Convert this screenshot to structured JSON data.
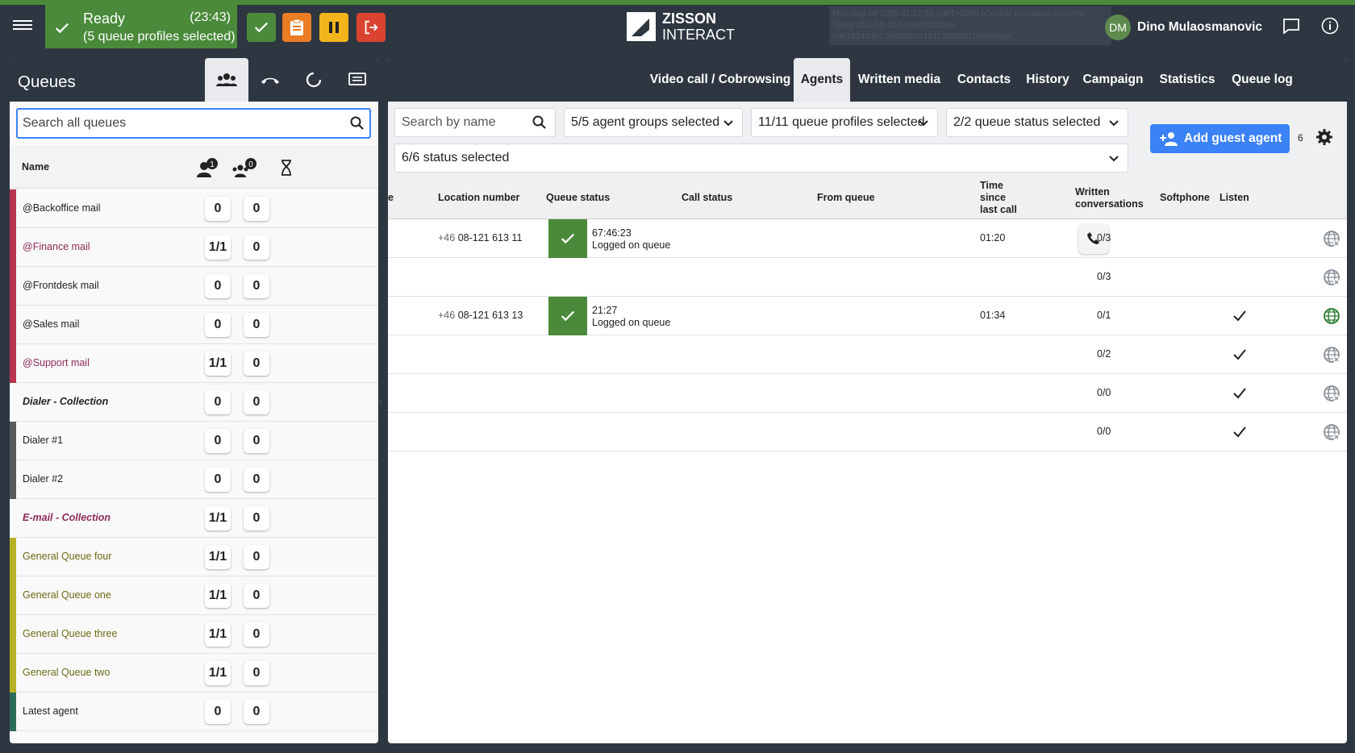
{
  "topbar": {
    "status": "Ready",
    "time": "(23:43)",
    "subtitle": "(5 queue profiles selected)",
    "brand_line1": "ZISSON",
    "brand_line2": "INTERACT",
    "version_info": "Mon Sep 08 2025 11:57:51 GMT+0200 (Central European Summer Time) 25.04.8-432-gcd67d345de cd67d345de17b66f0c4518112f682611beba4aaf",
    "user_initials": "DM",
    "user_name": "Dino Mulaosmanovic",
    "colors": {
      "ready": "#4a8a3a",
      "orange": "#ea7c22",
      "yellow": "#f2b51c",
      "red": "#d9432f",
      "accent_blue": "#3b82f6"
    }
  },
  "left": {
    "title": "Queues",
    "search_placeholder": "Search all queues",
    "col_name": "Name",
    "badge_agents": "1",
    "badge_groups": "0",
    "queues": [
      {
        "name": "@Backoffice mail",
        "a": "0",
        "b": "0",
        "color": "#b8334f",
        "style": "normal"
      },
      {
        "name": "@Finance mail",
        "a": "1/1",
        "b": "0",
        "color": "#b8334f",
        "style": "pink"
      },
      {
        "name": "@Frontdesk mail",
        "a": "0",
        "b": "0",
        "color": "#b8334f",
        "style": "normal"
      },
      {
        "name": "@Sales mail",
        "a": "0",
        "b": "0",
        "color": "#b8334f",
        "style": "normal"
      },
      {
        "name": "@Support mail",
        "a": "1/1",
        "b": "0",
        "color": "#b8334f",
        "style": "pink"
      },
      {
        "name": "Dialer - Collection",
        "a": "0",
        "b": "0",
        "color": "#f9f9f9",
        "style": "bold"
      },
      {
        "name": "Dialer #1",
        "a": "0",
        "b": "0",
        "color": "#5a5a5a",
        "style": "normal"
      },
      {
        "name": "Dialer #2",
        "a": "0",
        "b": "0",
        "color": "#5a5a5a",
        "style": "normal"
      },
      {
        "name": "E-mail - Collection",
        "a": "1/1",
        "b": "0",
        "color": "#f9f9f9",
        "style": "bold pink"
      },
      {
        "name": "General Queue four",
        "a": "1/1",
        "b": "0",
        "color": "#b7b325",
        "style": "olive"
      },
      {
        "name": "General Queue one",
        "a": "1/1",
        "b": "0",
        "color": "#b7b325",
        "style": "olive"
      },
      {
        "name": "General Queue three",
        "a": "1/1",
        "b": "0",
        "color": "#b7b325",
        "style": "olive"
      },
      {
        "name": "General Queue two",
        "a": "1/1",
        "b": "0",
        "color": "#b7b325",
        "style": "olive"
      },
      {
        "name": "Latest agent",
        "a": "0",
        "b": "0",
        "color": "#2f6b5a",
        "style": "normal"
      }
    ]
  },
  "right": {
    "tabs": [
      "Video call / Cobrowsing",
      "Agents",
      "Written media",
      "Contacts",
      "History",
      "Campaign",
      "Statistics",
      "Queue log"
    ],
    "search_placeholder": "Search by name",
    "filter_groups": "5/5 agent groups selected",
    "filter_profiles": "11/11 queue profiles selected",
    "filter_qstatus": "2/2 queue status selected",
    "filter_status": "6/6 status selected",
    "add_guest": "Add guest agent",
    "count": "6",
    "columns": {
      "partial": "e",
      "location": "Location number",
      "queue_status": "Queue status",
      "call_status": "Call status",
      "from_queue": "From queue",
      "time_since_1": "Time",
      "time_since_2": "since",
      "time_since_3": "last call",
      "written_1": "Written",
      "written_2": "conversations",
      "softphone": "Softphone",
      "listen": "Listen"
    },
    "rows": [
      {
        "prefix": "+46",
        "number": "08-121 613 11",
        "qtime": "67:46:23",
        "qstate": "Logged on queue",
        "since": "01:20",
        "written": "0/3",
        "softphone": false,
        "listen_active": false,
        "show_status": true,
        "phone": true
      },
      {
        "prefix": "",
        "number": "",
        "qtime": "",
        "qstate": "",
        "since": "",
        "written": "0/3",
        "softphone": false,
        "listen_active": false,
        "show_status": false,
        "phone": false
      },
      {
        "prefix": "+46",
        "number": "08-121 613 13",
        "qtime": "21:27",
        "qstate": "Logged on queue",
        "since": "01:34",
        "written": "0/1",
        "softphone": true,
        "listen_active": true,
        "show_status": true,
        "phone": false
      },
      {
        "prefix": "",
        "number": "",
        "qtime": "",
        "qstate": "",
        "since": "",
        "written": "0/2",
        "softphone": true,
        "listen_active": false,
        "show_status": false,
        "phone": false
      },
      {
        "prefix": "",
        "number": "",
        "qtime": "",
        "qstate": "",
        "since": "",
        "written": "0/0",
        "softphone": true,
        "listen_active": false,
        "show_status": false,
        "phone": false
      },
      {
        "prefix": "",
        "number": "",
        "qtime": "",
        "qstate": "",
        "since": "",
        "written": "0/0",
        "softphone": true,
        "listen_active": false,
        "show_status": false,
        "phone": false
      }
    ]
  }
}
